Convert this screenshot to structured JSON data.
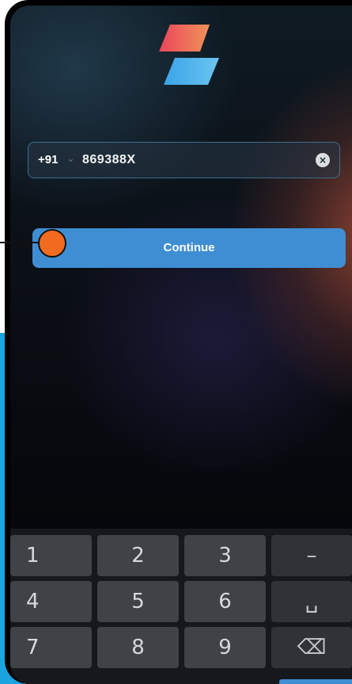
{
  "login": {
    "country_code": "+91",
    "phone_value": "869388X",
    "continue_label": "Continue"
  },
  "keyboard": {
    "row1": [
      "1",
      "2",
      "3",
      "–"
    ],
    "row2": [
      "4",
      "5",
      "6",
      "␣"
    ],
    "row3": [
      "7",
      "8",
      "9",
      "⌫"
    ]
  },
  "colors": {
    "accent": "#3f8ed3",
    "pointer": "#f06b1f",
    "cyan_band": "#1aa5e0"
  },
  "icons": {
    "logo": "app-logo-icon",
    "clear": "clear-icon",
    "dropdown": "chevron-down-icon",
    "backspace": "backspace-icon",
    "space": "space-icon"
  }
}
